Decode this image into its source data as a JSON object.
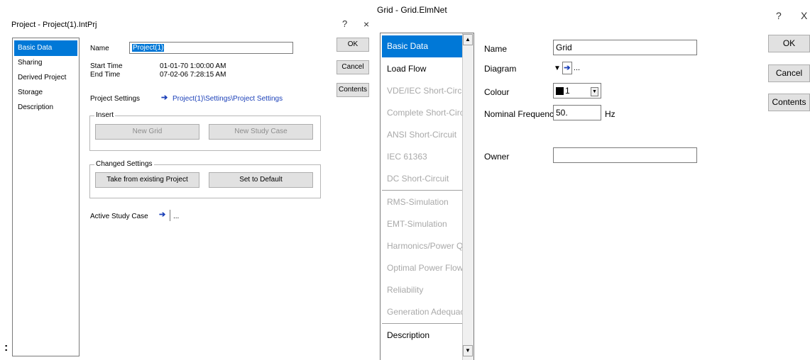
{
  "left_dialog": {
    "title": "Project - Project(1).IntPrj",
    "help_glyph": "?",
    "close_glyph": "×",
    "nav_items": [
      {
        "label": "Basic Data",
        "selected": true
      },
      {
        "label": "Sharing",
        "selected": false
      },
      {
        "label": "Derived Project",
        "selected": false
      },
      {
        "label": "Storage",
        "selected": false
      },
      {
        "label": "Description",
        "selected": false
      }
    ],
    "name_label": "Name",
    "name_value": "Project(1)",
    "start_time_label": "Start Time",
    "start_time_value": "01-01-70 1:00:00 AM",
    "end_time_label": "End Time",
    "end_time_value": "07-02-06 7:28:15 AM",
    "project_settings_label": "Project Settings",
    "project_settings_path": "Project(1)\\Settings\\Project Settings",
    "insert_group_title": "Insert",
    "new_grid_label": "New Grid",
    "new_study_case_label": "New Study Case",
    "changed_settings_title": "Changed Settings",
    "take_from_existing_label": "Take from existing Project",
    "set_to_default_label": "Set to Default",
    "active_study_case_label": "Active Study Case",
    "ellipsis": "...",
    "ok_label": "OK",
    "cancel_label": "Cancel",
    "contents_label": "Contents",
    "stray_glyph": ":"
  },
  "right_dialog": {
    "title": "Grid - Grid.ElmNet",
    "help_glyph": "?",
    "close_glyph": "X",
    "nav_items": [
      {
        "label": "Basic Data",
        "state": "selected"
      },
      {
        "label": "Load Flow",
        "state": "enabled"
      },
      {
        "label": "VDE/IEC Short-Circuit",
        "state": "disabled"
      },
      {
        "label": "Complete Short-Circuit",
        "state": "disabled"
      },
      {
        "label": "ANSI Short-Circuit",
        "state": "disabled"
      },
      {
        "label": "IEC 61363",
        "state": "disabled"
      },
      {
        "label": "DC Short-Circuit",
        "state": "disabled"
      },
      {
        "label": "RMS-Simulation",
        "state": "disabled"
      },
      {
        "label": "EMT-Simulation",
        "state": "disabled"
      },
      {
        "label": "Harmonics/Power Quality",
        "state": "disabled"
      },
      {
        "label": "Optimal Power Flow",
        "state": "disabled"
      },
      {
        "label": "Reliability",
        "state": "disabled"
      },
      {
        "label": "Generation Adequacy",
        "state": "disabled"
      },
      {
        "label": "Description",
        "state": "enabled"
      }
    ],
    "name_label": "Name",
    "name_value": "Grid",
    "diagram_label": "Diagram",
    "colour_label": "Colour",
    "colour_value": "1",
    "colour_swatch": "#000000",
    "nominal_frequency_label": "Nominal Frequency",
    "nominal_frequency_value": "50.",
    "frequency_unit": "Hz",
    "owner_label": "Owner",
    "owner_value": "",
    "ellipsis": "...",
    "ok_label": "OK",
    "cancel_label": "Cancel",
    "contents_label": "Contents"
  },
  "colors": {
    "selection": "#0078d7",
    "link": "#1a3fb8",
    "disabled_text": "#a9a9a9"
  }
}
